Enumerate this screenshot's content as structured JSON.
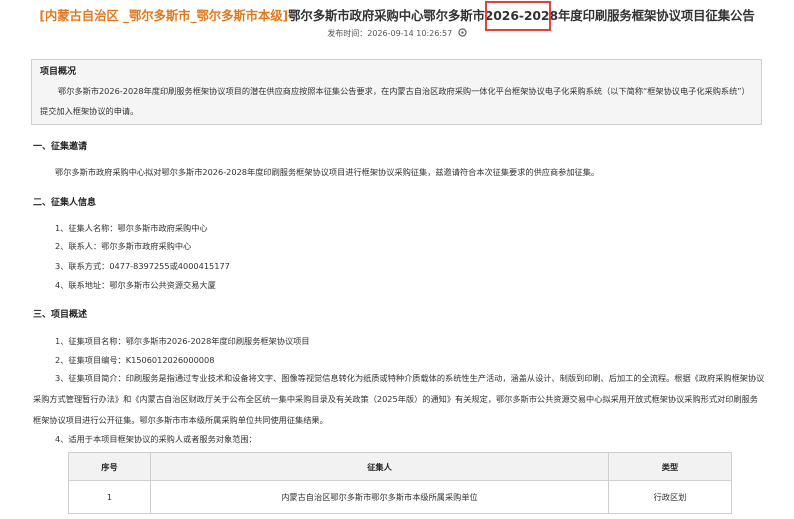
{
  "header": {
    "region": "[内蒙古自治区 _鄂尔多斯市_鄂尔多斯市本级]",
    "title_prefix": "鄂尔多斯市政府采购中心鄂尔多斯市",
    "title_year": "2026-2028",
    "title_suffix": "年度印刷服务框架协议项目征集公告",
    "publish_label": "发布时间：",
    "publish_time": "2026-09-14 10:26:57",
    "icon": "wheel-icon"
  },
  "overview": {
    "title": "项目概况",
    "body": "鄂尔多斯市2026-2028年度印刷服务框架协议项目的潜在供应商应按照本征集公告要求，在内蒙古自治区政府采购一体化平台框架协议电子化采购系统（以下简称“框架协议电子化采购系统”）提交加入框架协议的申请。"
  },
  "sections": {
    "s1": {
      "title": "一、征集邀请",
      "body": "鄂尔多斯市政府采购中心拟对鄂尔多斯市2026-2028年度印刷服务框架协议项目进行框架协议采购征集，兹邀请符合本次征集要求的供应商参加征集。"
    },
    "s2": {
      "title": "二、征集人信息",
      "items": [
        "1、征集人名称：鄂尔多斯市政府采购中心",
        "2、联系人：鄂尔多斯市政府采购中心",
        "3、联系方式：0477-8397255或4000415177",
        "4、联系地址：鄂尔多斯市公共资源交易大厦"
      ]
    },
    "s3": {
      "title": "三、项目概述",
      "items": [
        "1、征集项目名称：鄂尔多斯市2026-2028年度印刷服务框架协议项目",
        "2、征集项目编号：K1506012026000008"
      ],
      "item3": "3、征集项目简介：印刷服务是指通过专业技术和设备将文字、图像等视觉信息转化为纸质或特种介质载体的系统性生产活动，涵盖从设计、制版到印刷、后加工的全流程。根据《政府采购框架协议采购方式管理暂行办法》和《内蒙古自治区财政厅关于公布全区统一集中采购目录及有关政策（2025年版）的通知》有关规定，鄂尔多斯市公共资源交易中心拟采用开放式框架协议采购形式对印刷服务框架协议项目进行公开征集。鄂尔多斯市市本级所属采购单位共同使用征集结果。",
      "item4": "4、适用于本项目框架协议的采购人或者服务对象范围："
    }
  },
  "table": {
    "headers": [
      "序号",
      "征集人",
      "类型"
    ],
    "rows": [
      [
        "1",
        "内蒙古自治区鄂尔多斯市鄂尔多斯市本级所属采购单位",
        "行政区划"
      ]
    ]
  }
}
